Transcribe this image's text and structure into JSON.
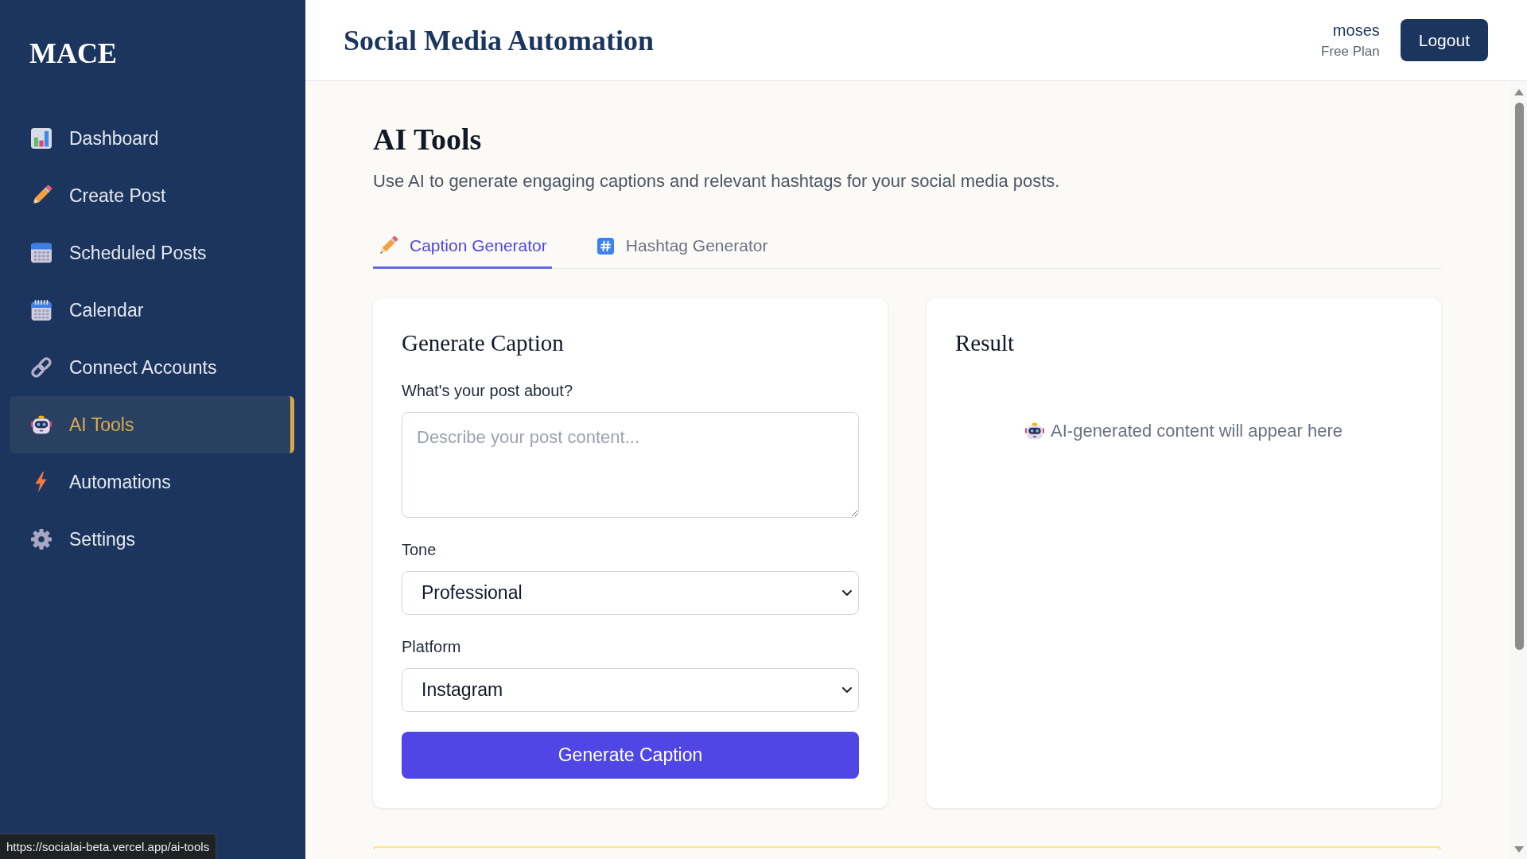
{
  "sidebar": {
    "logo": "MACE",
    "items": [
      {
        "label": "Dashboard",
        "selected": false
      },
      {
        "label": "Create Post",
        "selected": false
      },
      {
        "label": "Scheduled Posts",
        "selected": false
      },
      {
        "label": "Calendar",
        "selected": false
      },
      {
        "label": "Connect Accounts",
        "selected": false
      },
      {
        "label": "AI Tools",
        "selected": true
      },
      {
        "label": "Automations",
        "selected": false
      },
      {
        "label": "Settings",
        "selected": false
      }
    ]
  },
  "header": {
    "title": "Social Media Automation",
    "user": {
      "name": "moses",
      "plan": "Free Plan"
    },
    "logout_button": "Logout"
  },
  "page": {
    "title": "AI Tools",
    "subtitle": "Use AI to generate engaging captions and relevant hashtags for your social media posts."
  },
  "tabs": [
    {
      "label": "Caption Generator",
      "selected": true
    },
    {
      "label": "Hashtag Generator",
      "selected": false
    }
  ],
  "caption_form": {
    "title": "Generate Caption",
    "fields": [
      {
        "kind": "textarea",
        "label": "What's your post about?",
        "placeholder": "Describe your post content..."
      },
      {
        "kind": "select",
        "label": "Tone",
        "value": "Professional"
      },
      {
        "kind": "select",
        "label": "Platform",
        "value": "Instagram"
      }
    ],
    "submit_button": "Generate Caption"
  },
  "result": {
    "title": "Result",
    "placeholder": "AI-generated content will appear here"
  },
  "status_url": "https://socialai-beta.vercel.app/ai-tools"
}
